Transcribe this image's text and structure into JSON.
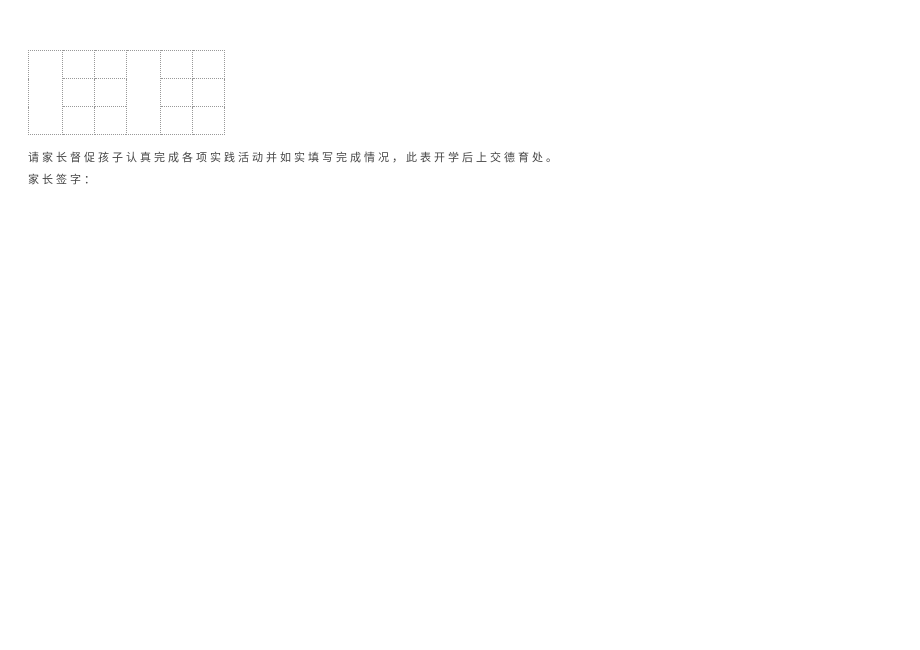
{
  "text": {
    "instruction": "请家长督促孩子认真完成各项实践活动并如实填写完成情况，此表开学后上交德育处。",
    "signature_label": "家长签字："
  }
}
